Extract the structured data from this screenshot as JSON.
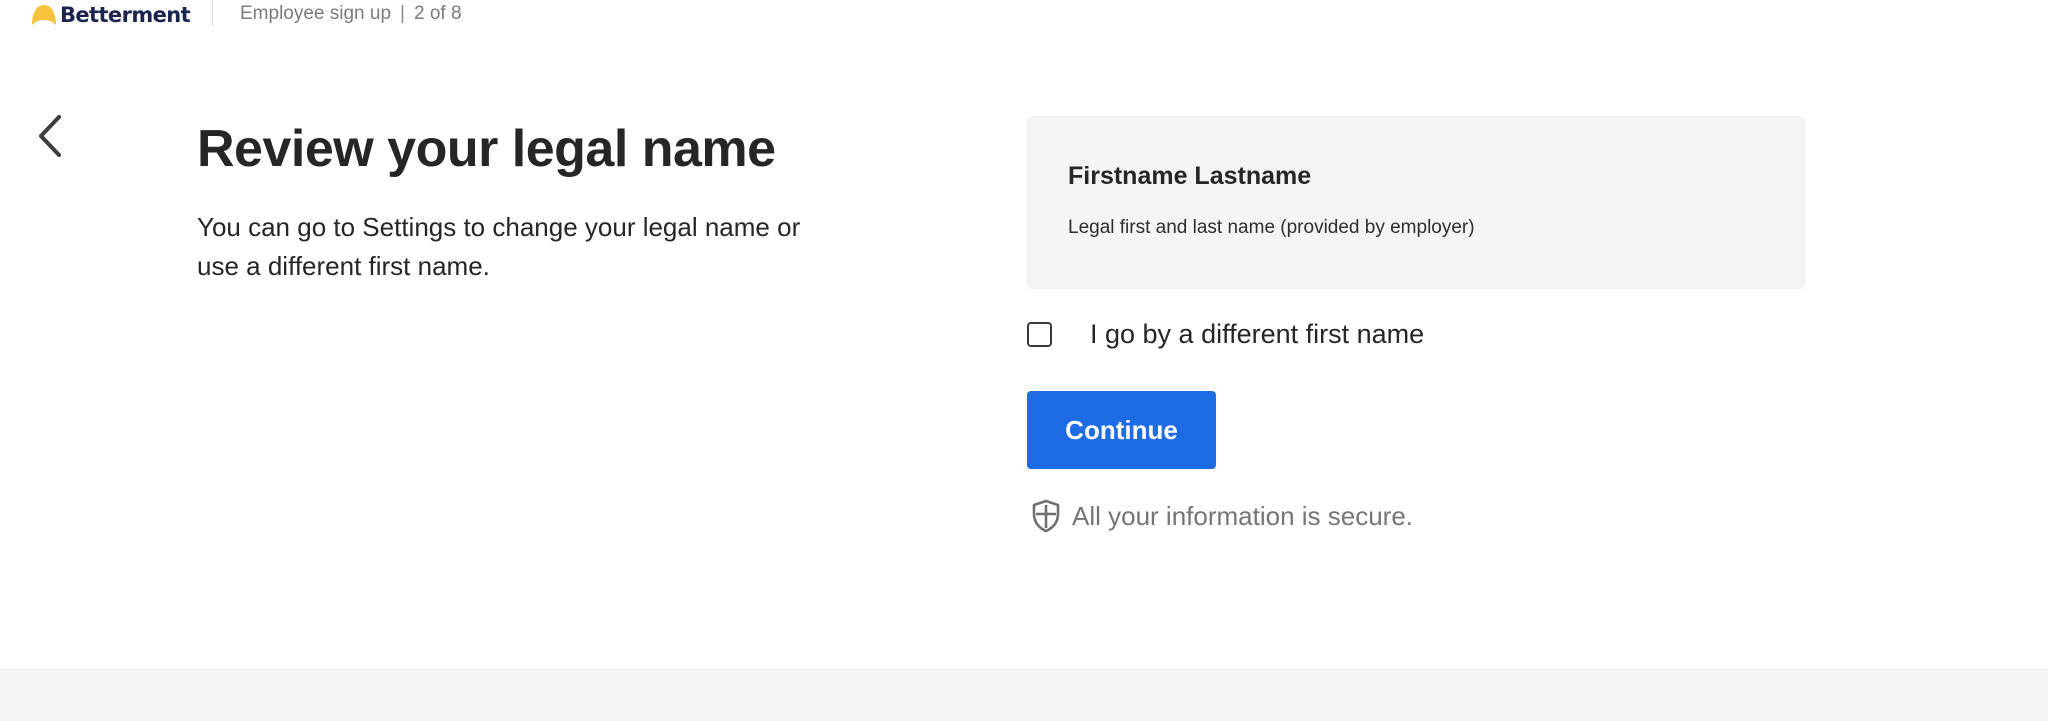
{
  "header": {
    "logo_text": "Betterment",
    "step_label": "Employee sign up",
    "separator": "|",
    "step_count": "2 of 8"
  },
  "main": {
    "title": "Review your legal name",
    "description": "You can go to Settings to change your legal name or use a different first name."
  },
  "name_card": {
    "name": "Firstname Lastname",
    "note": "Legal first and last name (provided by employer)"
  },
  "checkbox": {
    "label": "I go by a different first name",
    "checked": false
  },
  "continue_button": {
    "label": "Continue"
  },
  "secure_message": "All your information is secure.",
  "icons": {
    "back": "chevron-left-icon",
    "secure": "shield-icon",
    "logo": "betterment-logo-icon"
  },
  "colors": {
    "primary_button": "#1d6ce3",
    "logo_text": "#1b2451",
    "logo_mark": "#f7c23c",
    "card_background": "#f4f4f4",
    "muted_text": "#757575"
  }
}
